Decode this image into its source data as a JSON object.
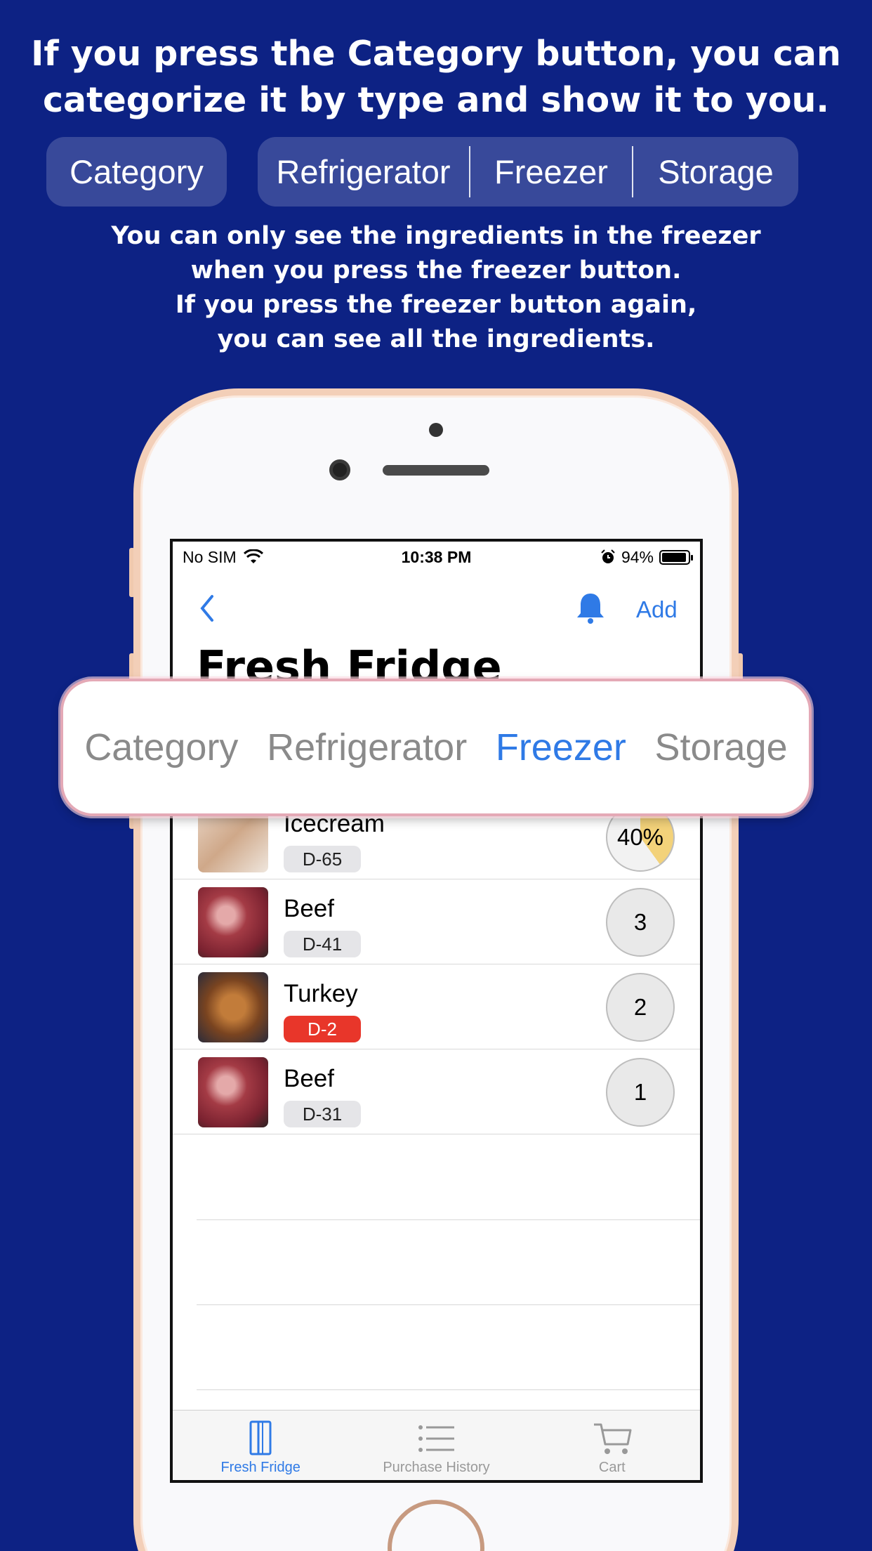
{
  "headline": {
    "line1": "If you press the Category button, you can",
    "line2": "categorize it by type and show it to you."
  },
  "top_buttons": {
    "category": "Category",
    "refrigerator": "Refrigerator",
    "freezer": "Freezer",
    "storage": "Storage"
  },
  "subtext": {
    "line1": "You can only see the ingredients in the freezer",
    "line2": "when you press the freezer button.",
    "line3": "If you press the freezer button again,",
    "line4": "you can see all the ingredients."
  },
  "statusbar": {
    "carrier": "No SIM",
    "time": "10:38 PM",
    "battery": "94%",
    "battery_level": 0.94
  },
  "navbar": {
    "add_label": "Add",
    "title": "Fresh Fridge"
  },
  "overlay_tabs": {
    "category": "Category",
    "refrigerator": "Refrigerator",
    "freezer": "Freezer",
    "storage": "Storage",
    "active": "Freezer"
  },
  "items": [
    {
      "name": "Icecream",
      "dday": "D-65",
      "count": "40%",
      "urgent": false
    },
    {
      "name": "Beef",
      "dday": "D-41",
      "count": "3",
      "urgent": false
    },
    {
      "name": "Turkey",
      "dday": "D-2",
      "count": "2",
      "urgent": true
    },
    {
      "name": "Beef",
      "dday": "D-31",
      "count": "1",
      "urgent": false
    }
  ],
  "tabbar": {
    "fresh_fridge": "Fresh Fridge",
    "purchase_history": "Purchase History",
    "cart": "Cart",
    "active": "Fresh Fridge"
  },
  "colors": {
    "background": "#0d2284",
    "accent": "#2f7ae6",
    "urgent": "#e8362a"
  }
}
